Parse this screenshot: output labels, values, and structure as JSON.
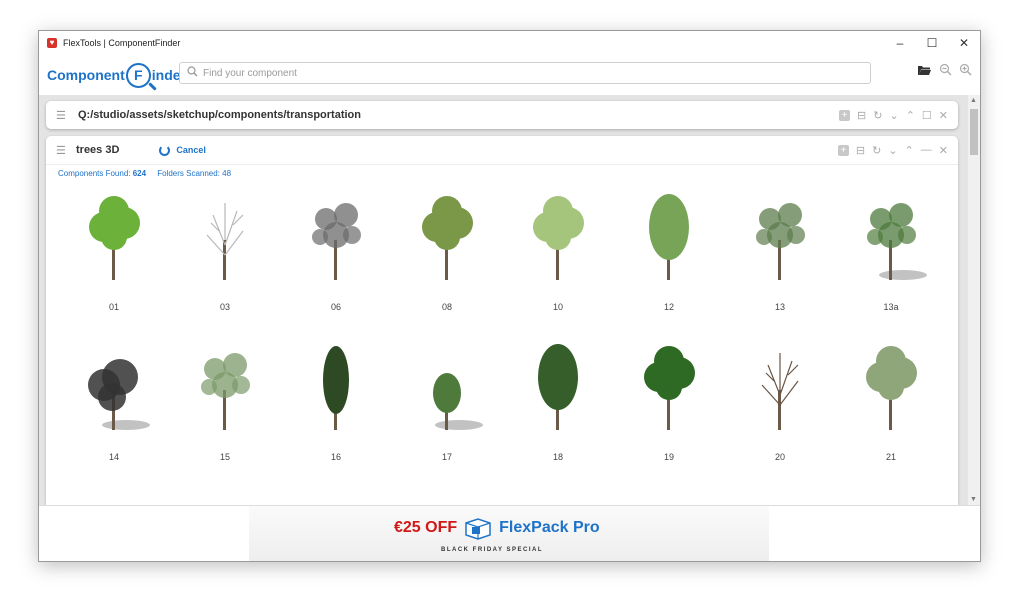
{
  "window": {
    "title": "FlexTools | ComponentFinder",
    "controls": {
      "minimize": "–",
      "maximize": "☐",
      "close": "✕"
    }
  },
  "logo": {
    "pre": "Component",
    "letter": "F",
    "post": "inder"
  },
  "search": {
    "placeholder": "Find your component",
    "value": ""
  },
  "toolbar_icons": [
    "folder-open-icon",
    "zoom-out-icon",
    "zoom-in-icon"
  ],
  "pathbar": {
    "path": "Q:/studio/assets/sketchup/components/transportation"
  },
  "panel": {
    "title": "trees 3D",
    "cancel_label": "Cancel",
    "stats": {
      "found_label": "Components Found:",
      "found_value": "624",
      "scanned_label": "Folders Scanned:",
      "scanned_value": "48"
    }
  },
  "items": [
    {
      "label": "01",
      "style": "broad",
      "color": "#6cb23a"
    },
    {
      "label": "03",
      "style": "bare",
      "color": "#b8b8b8"
    },
    {
      "label": "06",
      "style": "sparse",
      "color": "#6b6b6b"
    },
    {
      "label": "08",
      "style": "broad",
      "color": "#7a9848"
    },
    {
      "label": "10",
      "style": "broad",
      "color": "#a5c47c"
    },
    {
      "label": "12",
      "style": "oval",
      "color": "#78a458"
    },
    {
      "label": "13",
      "style": "sparse",
      "color": "#5c7c4c"
    },
    {
      "label": "13a",
      "style": "sparse",
      "color": "#4e7a3c",
      "shadow": true
    },
    {
      "label": "14",
      "style": "bush",
      "color": "#333333",
      "shadow": true
    },
    {
      "label": "15",
      "style": "sparse",
      "color": "#7c9a6a"
    },
    {
      "label": "16",
      "style": "narrow",
      "color": "#2d4a24"
    },
    {
      "label": "17",
      "style": "small",
      "color": "#4e7a3c",
      "shadow": true
    },
    {
      "label": "18",
      "style": "oval",
      "color": "#355e2b"
    },
    {
      "label": "19",
      "style": "broad",
      "color": "#2e6a24"
    },
    {
      "label": "20",
      "style": "bare",
      "color": "#6a5545"
    },
    {
      "label": "21",
      "style": "broad",
      "color": "#8fa67a"
    }
  ],
  "banner": {
    "offer": "€25 OFF",
    "product": "FlexPack Pro",
    "subtitle": "BLACK FRIDAY SPECIAL"
  },
  "colors": {
    "accent": "#1e73c8",
    "offer": "#d01818"
  }
}
